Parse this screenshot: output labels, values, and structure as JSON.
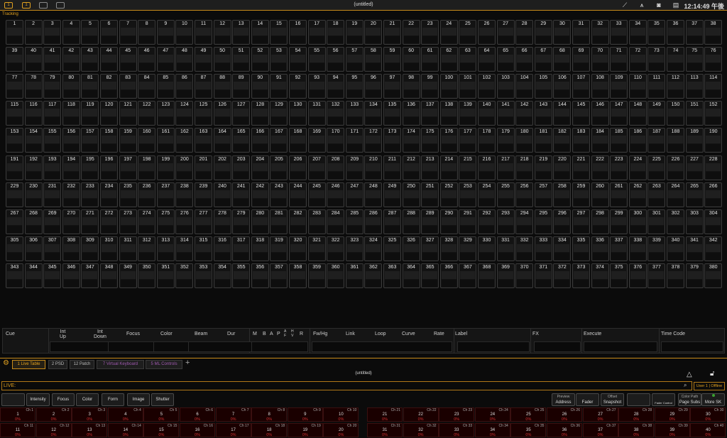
{
  "topbar": {
    "title": "(untitled)",
    "clock": "12:14:49 午後",
    "screen_btn1": "1",
    "screen_btn2": "1"
  },
  "mode_label": "Tracking",
  "channels": {
    "start": 1,
    "end": 380,
    "per_row": 38
  },
  "cue_table": {
    "headers": [
      "Cue",
      "Int\nUp",
      "Int\nDown",
      "Focus",
      "Color",
      "Beam",
      "Dur",
      "M",
      "B",
      "A",
      "P",
      "A\nF",
      "H\nV",
      "R",
      "Fw/Hg",
      "Link",
      "Loop",
      "Curve",
      "Rate",
      "Label",
      "FX",
      "Execute",
      "Time Code"
    ]
  },
  "tabs": [
    {
      "label": "1 Live Table",
      "state": "active"
    },
    {
      "label": "2 PSD",
      "state": "normal"
    },
    {
      "label": "12 Patch",
      "state": "normal"
    },
    {
      "label": "7 Virtual Keyboard",
      "state": "purple"
    },
    {
      "label": "5 ML Controls",
      "state": "purple"
    }
  ],
  "subtitle": "(untitled)",
  "command_line": {
    "label": "LIVE:"
  },
  "user": "User 1 | Offline",
  "softkeys": {
    "left": [
      "Intensity",
      "Focus",
      "Color",
      "Form",
      "Image",
      "Shutter"
    ],
    "right": [
      {
        "top": "Preview",
        "bottom": "Address"
      },
      {
        "top": "",
        "bottom": "Fader"
      },
      {
        "top": "Offset",
        "bottom": "Snapshot"
      },
      {
        "top": "",
        "bottom": ""
      },
      {
        "top": "",
        "bottom": "Fader Control"
      },
      {
        "top": "Color Path",
        "bottom": "Page Subs"
      },
      {
        "top": "",
        "bottom": "More SK"
      }
    ]
  },
  "faders": {
    "prefix": "Ch",
    "value": "0%",
    "count": 40
  },
  "colors": {
    "accent": "#e0a020",
    "value_red": "#d03030"
  }
}
